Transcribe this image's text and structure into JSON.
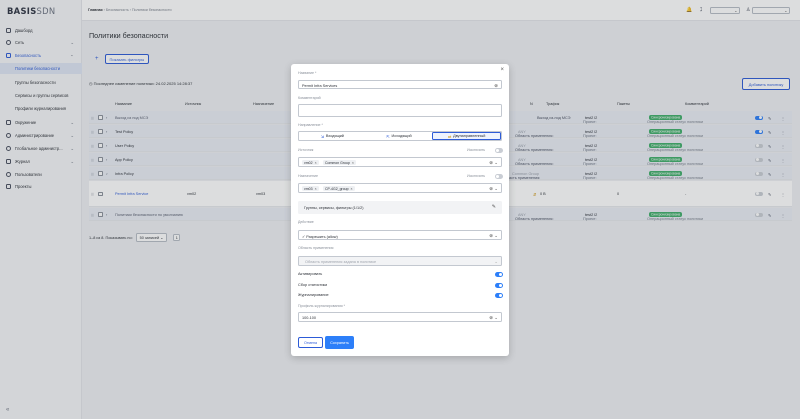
{
  "app": {
    "logo_main": "BASIS",
    "logo_sub": "SDN"
  },
  "sidebar": {
    "items": [
      {
        "label": "Дашборд",
        "icon": "grid-icon"
      },
      {
        "label": "Сеть",
        "icon": "globe-icon"
      },
      {
        "label": "Безопасность",
        "icon": "shield-icon"
      },
      {
        "label": "Политики безопасности",
        "sub": true
      },
      {
        "label": "Группы безопасности",
        "sub": true
      },
      {
        "label": "Сервисы и группы сервисов",
        "sub": true
      },
      {
        "label": "Профили журналирования",
        "sub": true
      },
      {
        "label": "Окружение",
        "icon": "layers-icon"
      },
      {
        "label": "Администрирование",
        "icon": "settings-icon"
      },
      {
        "label": "Глобальное администр...",
        "icon": "globe-settings-icon"
      },
      {
        "label": "Журнал",
        "icon": "journal-icon"
      },
      {
        "label": "Пользователи",
        "icon": "users-icon"
      },
      {
        "label": "Проекты",
        "icon": "projects-icon"
      }
    ],
    "chevron": "⌄",
    "collapse": "«"
  },
  "topbar": {
    "crumb1": "Главная",
    "crumb_sep": " › ",
    "crumb2": "Безопасность",
    "crumb3": "Политики безопасности",
    "bell": "🔔",
    "translate": "ℷ",
    "user_icon": "♙"
  },
  "page": {
    "title": "Политики безопасности",
    "add_filter": "Показать фильтры",
    "last_change": "Последнее изменение политики: 24.02.2025 14:28:37",
    "add_policy": "Добавить политику"
  },
  "table": {
    "headers": {
      "name": "Название",
      "source": "Источник",
      "dest": "Назначение",
      "n": "N",
      "traffic": "Трафик",
      "packets": "Пакеты",
      "comment": "Комментарий"
    },
    "rows": [
      {
        "name": "Выход из под МСЭ",
        "traffic": "Выход из-под МСЭ",
        "scope": "Область применения:",
        "scope_val": "ANY",
        "proj": "Проект:",
        "proj_val": "test2 l2",
        "status": "Операционный статус политики",
        "badge": "Синхронизирована"
      },
      {
        "name": "Test Policy",
        "scope": "Область применения:",
        "scope_val": "ANY",
        "proj": "Проект:",
        "proj_val": "test2 l2",
        "status": "Операционный статус политики",
        "badge": "Синхронизирована"
      },
      {
        "name": "User Policy",
        "scope": "Область применения:",
        "scope_val": "ANY",
        "proj": "Проект:",
        "proj_val": "test2 l2",
        "status": "Операционный статус политики",
        "badge": "Синхронизирована"
      },
      {
        "name": "App Policy",
        "scope": "Область применения:",
        "scope_val": "ANY",
        "proj": "Проект:",
        "proj_val": "test2 l2",
        "status": "Операционный статус политики",
        "badge": "Синхронизирована"
      },
      {
        "name": "Infra Policy",
        "scope": "асть применения:",
        "scope_val": "Common Group",
        "proj": "Проект:",
        "proj_val": "test2 l2",
        "status": "Операционный статус политики",
        "badge": "Синхронизирована"
      },
      {
        "name": "Permit Infra Service",
        "source": "vm02",
        "dest": "vm03",
        "n": "0 B",
        "packets": "0",
        "comment": "-"
      },
      {
        "name": "Политики безопасности по умолчанию",
        "scope": "Область применения:",
        "scope_val": "ANY",
        "proj": "Проект:",
        "proj_val": "test2 l2",
        "status": "Операционный статус политики",
        "badge": "Синхронизирована"
      }
    ],
    "pager": {
      "text": "1–8 из 8. Показывать по:",
      "size": "50 записей",
      "page": "1"
    }
  },
  "modal": {
    "name_label": "Название *",
    "name_value": "Permit Infra Services",
    "comment_label": "Комментарий",
    "direction_label": "Направление *",
    "dir_in": "Входящий",
    "dir_out": "Исходящий",
    "dir_both": "Двунаправленный",
    "source_label": "Источник",
    "exclude_label": "Исключить",
    "source_chips": [
      "vm02",
      "Common Group"
    ],
    "dest_label": "Назначение",
    "dest_chips": [
      "vm03",
      "CP-4G2_group"
    ],
    "groups": "Группы, сервисы, фильтры (1/1/2)",
    "action_label": "Действие",
    "action_value": "✓ Разрешить (allow)",
    "scope_label": "Область применения",
    "scope_placeholder": "Область применения задана в политике",
    "activate": "Активировать",
    "stats": "Сбор статистики",
    "logging": "Журналирование",
    "log_profile_label": "Профиль журналирования *",
    "log_profile_value": "100-100",
    "cancel": "Отмена",
    "save": "Сохранить"
  }
}
